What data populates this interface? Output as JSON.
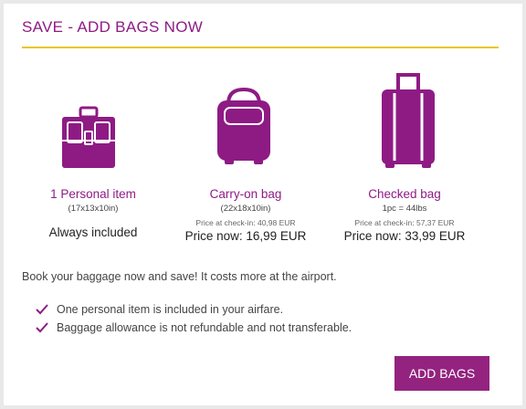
{
  "header": {
    "title": "SAVE - ADD BAGS NOW"
  },
  "colors": {
    "brand": "#8e1b84",
    "accent_rule": "#e8c61b",
    "button": "#93237f"
  },
  "bags": [
    {
      "icon": "personal-item-icon",
      "name": "1 Personal item",
      "dims": "(17x13x10in)",
      "note": "Always included"
    },
    {
      "icon": "carry-on-bag-icon",
      "name": "Carry-on bag",
      "dims": "(22x18x10in)",
      "checkin_price": "Price at check-in: 40,98 EUR",
      "price_now": "Price now: 16,99 EUR"
    },
    {
      "icon": "checked-bag-icon",
      "name": "Checked bag",
      "dims": "1pc = 44lbs",
      "checkin_price": "Price at check-in: 57,37 EUR",
      "price_now": "Price now: 33,99 EUR"
    }
  ],
  "info": {
    "book_text": "Book your baggage now and save! It costs more at the airport.",
    "bullets": [
      "One personal item is included in your airfare.",
      "Baggage allowance is not refundable and not transferable."
    ]
  },
  "actions": {
    "add_bags": "ADD BAGS"
  }
}
